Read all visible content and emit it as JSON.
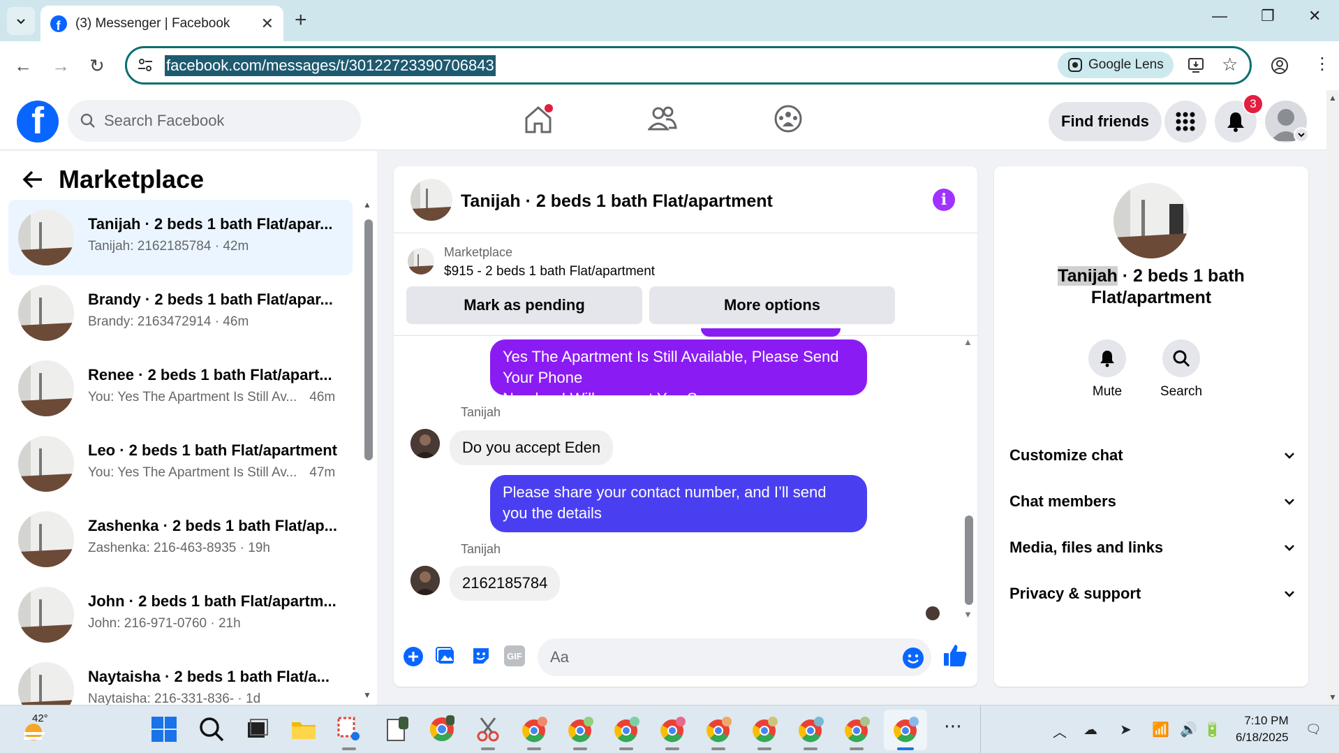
{
  "browser": {
    "tab_title": "(3) Messenger | Facebook",
    "url": "facebook.com/messages/t/30122723390706843",
    "google_lens_label": "Google Lens"
  },
  "header": {
    "search_placeholder": "Search Facebook",
    "find_friends_label": "Find friends",
    "notification_count": "3"
  },
  "left_panel": {
    "title": "Marketplace",
    "conversations": [
      {
        "name": "Tanijah · 2 beds 1 bath Flat/apar...",
        "preview": "Tanijah: 2162185784 · 42m",
        "active": true
      },
      {
        "name": "Brandy · 2 beds 1 bath Flat/apar...",
        "preview": "Brandy: 2163472914 · 46m"
      },
      {
        "name": "Renee · 2 beds 1 bath Flat/apart...",
        "preview": "You: Yes The Apartment Is Still Av...",
        "time": "46m"
      },
      {
        "name": "Leo · 2 beds 1 bath Flat/apartment",
        "preview": "You: Yes The Apartment Is Still Av...",
        "time": "47m"
      },
      {
        "name": "Zashenka · 2 beds 1 bath Flat/ap...",
        "preview": "Zashenka: 216-463-8935 · 19h"
      },
      {
        "name": "John · 2 beds 1 bath Flat/apartm...",
        "preview": "John: 216-971-0760 · 21h"
      },
      {
        "name": "Naytaisha · 2 beds 1 bath Flat/a...",
        "preview": "Naytaisha: 216-331-836- · 1d"
      }
    ]
  },
  "chat": {
    "title": "Tanijah · 2 beds 1 bath Flat/apartment",
    "listing_label": "Marketplace",
    "listing_price": "$915 - 2 beds 1 bath Flat/apartment",
    "mark_pending_label": "Mark as pending",
    "more_options_label": "More options",
    "messages": [
      {
        "from": "me",
        "line1": "Yes The Apartment Is Still Available, Please Send Your Phone",
        "line2": "Number I Will connact You Soon"
      },
      {
        "from": "Tanijah",
        "sender": "Tanijah",
        "text": "Do you accept Eden"
      },
      {
        "from": "me",
        "line1": "Please share your contact number, and I’ll send you the details",
        "line2": "."
      },
      {
        "from": "Tanijah",
        "sender": "Tanijah",
        "text": "2162185784"
      }
    ],
    "composer_placeholder": "Aa"
  },
  "right_panel": {
    "name_highlight": "Tanijah",
    "title_rest": " · 2 beds 1 bath",
    "title_line2": "Flat/apartment",
    "mute_label": "Mute",
    "search_label": "Search",
    "sections": [
      "Customize chat",
      "Chat members",
      "Media, files and links",
      "Privacy & support"
    ]
  },
  "taskbar": {
    "temperature": "42°",
    "time": "7:10 PM",
    "date": "6/18/2025"
  },
  "colors": {
    "fb_blue": "#0866ff",
    "outgoing_purple": "#8a1cf3",
    "outgoing_blue": "#4a3ff0",
    "info_purple": "#a033ff",
    "badge_red": "#e41e3f"
  }
}
